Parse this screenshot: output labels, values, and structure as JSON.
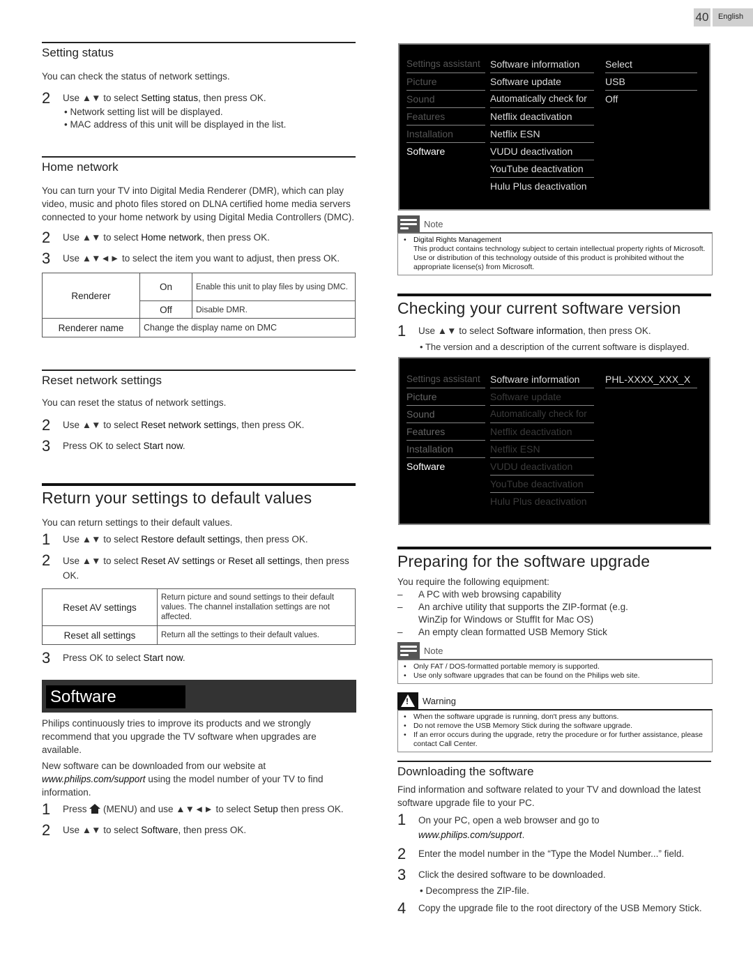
{
  "page": {
    "number": "40",
    "language": "English"
  },
  "left": {
    "setting_status": {
      "heading": "Setting status",
      "intro": "You can check the status of network settings.",
      "step2": {
        "num": "2",
        "pre": "Use ▲▼ to select ",
        "key": "Setting status",
        "post": ", then press OK."
      },
      "bullets": [
        "Network setting list will be displayed.",
        "MAC address of this unit will be displayed in the list."
      ]
    },
    "home_network": {
      "heading": "Home network",
      "intro": "You can turn your TV into Digital Media Renderer (DMR), which can play video, music and photo files stored on DLNA certified home media servers connected to your home network by using Digital Media Controllers (DMC).",
      "step2": {
        "num": "2",
        "pre": "Use ▲▼ to select ",
        "key": "Home network",
        "post": ", then press OK."
      },
      "step3": {
        "num": "3",
        "text": "Use ▲▼◄► to select the item you want to adjust, then press OK."
      },
      "table": {
        "renderer": "Renderer",
        "on": "On",
        "on_desc": "Enable this unit to play files by using DMC.",
        "off": "Off",
        "off_desc": "Disable DMR.",
        "renderer_name": "Renderer name",
        "renderer_name_desc": "Change the display name on DMC"
      }
    },
    "reset_network": {
      "heading": "Reset network settings",
      "intro": "You can reset the status of network settings.",
      "step2": {
        "num": "2",
        "pre": "Use ▲▼ to select ",
        "key": "Reset network settings",
        "post": ", then press OK."
      },
      "step3": {
        "num": "3",
        "pre": "Press OK to select ",
        "key": "Start now",
        "post": "."
      }
    },
    "return_defaults": {
      "heading": "Return your settings to default values",
      "intro": "You can return settings to their default values.",
      "step1": {
        "num": "1",
        "pre": "Use ▲▼ to select ",
        "key": "Restore default settings",
        "post": ", then press OK."
      },
      "step2": {
        "num": "2",
        "pre": "Use ▲▼ to select ",
        "key": "Reset AV settings",
        "mid": " or ",
        "key2": "Reset all settings",
        "post": ", then press OK."
      },
      "table": [
        {
          "name": "Reset AV settings",
          "desc": "Return picture and sound settings to their default values. The channel installation settings are not affected."
        },
        {
          "name": "Reset all settings",
          "desc": "Return all the settings to their default values."
        }
      ],
      "step3": {
        "num": "3",
        "pre": "Press OK to select ",
        "key": "Start now",
        "post": "."
      }
    },
    "software": {
      "banner": "Software",
      "para1": "Philips continuously tries to improve its products and we strongly recommend that you upgrade the TV software when upgrades are available.",
      "para2_pre": "New software can be downloaded from our website at ",
      "para2_url": "www.philips.com/support",
      "para2_post": " using the model number of your TV to find information.",
      "step1": {
        "num": "1",
        "pre": "Press ",
        "menu": " (MENU) and use ▲▼◄► to select ",
        "key": "Setup",
        "post": " then press OK."
      },
      "step2": {
        "num": "2",
        "pre": "Use ▲▼ to select ",
        "key": "Software",
        "post": ", then press OK."
      }
    }
  },
  "right": {
    "tv_menu_1": {
      "categories": [
        "Settings assistant",
        "Picture",
        "Sound",
        "Features",
        "Installation",
        "Software"
      ],
      "items": [
        "Software information",
        "Software update",
        "Automatically check for",
        "Netflix deactivation",
        "Netflix ESN",
        "VUDU deactivation",
        "YouTube deactivation",
        "Hulu Plus deactivation"
      ],
      "options": [
        "Select",
        "USB",
        "Off"
      ]
    },
    "note_drm": {
      "label": "Note",
      "title": "Digital Rights Management",
      "body": "This product contains technology subject to certain intellectual property rights of Microsoft. Use or distribution of this technology outside of this product is prohibited without the appropriate license(s) from Microsoft."
    },
    "check_version": {
      "heading": "Checking your current software version",
      "step1": {
        "num": "1",
        "pre": "Use ▲▼ to select ",
        "key": "Software information",
        "post": ", then press OK."
      },
      "bullet": "The version and a description of the current software is displayed."
    },
    "tv_menu_2": {
      "categories": [
        "Settings assistant",
        "Picture",
        "Sound",
        "Features",
        "Installation",
        "Software"
      ],
      "items": [
        "Software information",
        "Software update",
        "Automatically check for",
        "Netflix deactivation",
        "Netflix ESN",
        "VUDU deactivation",
        "YouTube deactivation",
        "Hulu Plus deactivation"
      ],
      "version": "PHL-XXXX_XXX_X"
    },
    "prepare": {
      "heading": "Preparing for the software upgrade",
      "intro": "You require the following equipment:",
      "items": [
        "A PC with web browsing capability",
        "An archive utility that supports the ZIP-format (e.g. WinZip for Windows or StuffIt for Mac OS)",
        "An empty clean formatted USB Memory Stick"
      ],
      "note_label": "Note",
      "notes": [
        "Only FAT / DOS-formatted portable memory is supported.",
        "Use only software upgrades that can be found on the Philips web site."
      ],
      "warning_label": "Warning",
      "warnings": [
        "When the software upgrade is running, don't press any buttons.",
        "Do not remove the USB Memory Stick during the software upgrade.",
        "If an error occurs during the upgrade, retry the procedure or for further assistance, please contact Call Center."
      ]
    },
    "download": {
      "heading": "Downloading the software",
      "intro": "Find information and software related to your TV and download the latest software upgrade file to your PC.",
      "step1": {
        "num": "1",
        "text": "On your PC, open a web browser and go to",
        "url": "www.philips.com/support",
        "post": "."
      },
      "step2": {
        "num": "2",
        "text": "Enter the model number in the “Type the Model Number...” field."
      },
      "step3": {
        "num": "3",
        "text": "Click the desired software to be downloaded."
      },
      "bullet": "Decompress the ZIP-file.",
      "step4": {
        "num": "4",
        "text": "Copy the upgrade file to the root directory of the USB Memory Stick."
      }
    }
  }
}
